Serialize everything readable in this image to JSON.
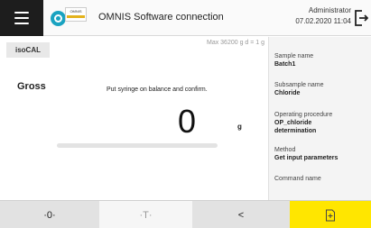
{
  "header": {
    "title": "OMNIS Software connection",
    "logo_text": "OMNIS",
    "user": "Administrator",
    "datetime": "07.02.2020  11:04"
  },
  "main": {
    "isocal_label": "isoCAL",
    "max_info": "Max 36200 g    d = 1 g",
    "mode": "Gross",
    "instruction": "Put syringe on balance and confirm.",
    "weight_value": "0",
    "unit": "g",
    "progress_fraction": 0.0
  },
  "sidebar": {
    "sample_name_label": "Sample name",
    "sample_name_value": "Batch1",
    "subsample_name_label": "Subsample name",
    "subsample_name_value": "Chloride",
    "operating_procedure_label": "Operating procedure",
    "operating_procedure_value_line1": "OP_chloride",
    "operating_procedure_value_line2": "determination",
    "method_label": "Method",
    "method_value": "Get input parameters",
    "command_name_label": "Command name"
  },
  "bottom_bar": {
    "zero_label": "·0·",
    "tare_label": "·T·",
    "back_label": "<",
    "confirm_icon": "save-icon"
  },
  "colors": {
    "confirm_button": "#ffe600",
    "menu_button": "#1d1d1d",
    "logo_accent": "#1aa3c1"
  }
}
